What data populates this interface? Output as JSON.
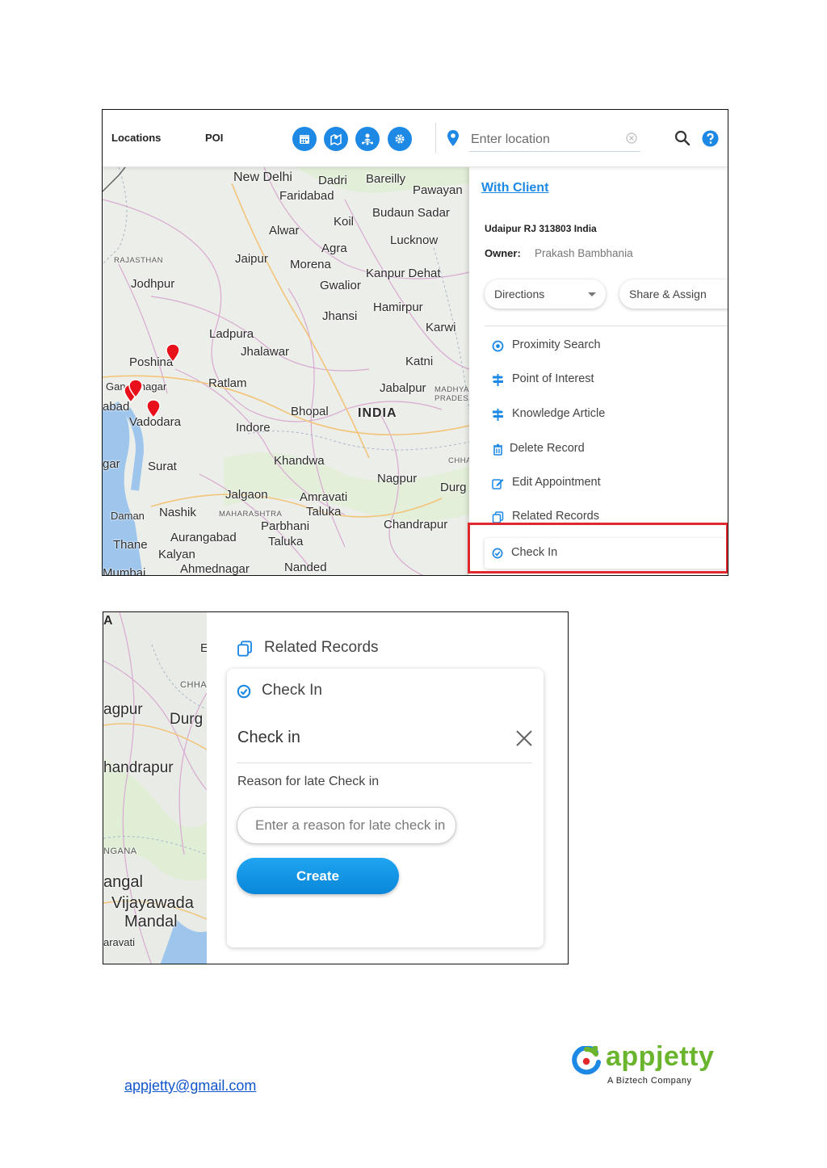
{
  "screen1": {
    "nav": {
      "locations": "Locations",
      "poi": "POI"
    },
    "toolbar_icons": [
      "calendar-icon",
      "map-route-icon",
      "user-network-icon",
      "settings-icon"
    ],
    "search": {
      "placeholder": "Enter location"
    },
    "map_labels": {
      "new_delhi": "New Delhi",
      "dadri": "Dadri",
      "bareilly": "Bareilly",
      "pawayan": "Pawayan",
      "faridabad": "Faridabad",
      "budaun_sadar": "Budaun Sadar",
      "koil": "Koil",
      "alwar": "Alwar",
      "lucknow": "Lucknow",
      "agra": "Agra",
      "rajasthan": "RAJASTHAN",
      "jaipur": "Jaipur",
      "morena": "Morena",
      "kanpur_dehat": "Kanpur Dehat",
      "jodhpur": "Jodhpur",
      "gwalior": "Gwalior",
      "hamirpur": "Hamirpur",
      "jhansi": "Jhansi",
      "karwi": "Karwi",
      "ladpura": "Ladpura",
      "jhalawar": "Jhalawar",
      "poshina": "Poshina",
      "katni": "Katni",
      "ratlam": "Ratlam",
      "jabalpur": "Jabalpur",
      "madhya": "MADHYA",
      "pradesh": "PRADESH",
      "bhopal": "Bhopal",
      "india": "INDIA",
      "vadodara": "Vadodara",
      "indore": "Indore",
      "khandwa": "Khandwa",
      "surat": "Surat",
      "nagpur": "Nagpur",
      "durg": "Durg",
      "jalgaon": "Jalgaon",
      "amravati_taluka": "Amravati",
      "taluka": "Taluka",
      "daman": "Daman",
      "nashik": "Nashik",
      "maharashtra": "MAHARASHTRA",
      "parbhani": "Parbhani",
      "chandrapur": "Chandrapur",
      "thane": "Thane",
      "aurangabad": "Aurangabad",
      "taluka2": "Taluka",
      "kalyan": "Kalyan",
      "nanded": "Nanded",
      "ahmednagar": "Ahmednagar",
      "mumbai": "Mumbai",
      "gandhinagar": "Gandhinagar",
      "ahmedabad": "abad",
      "gar": "gar",
      "chha": "CHHA"
    },
    "panel": {
      "title": "With Client",
      "address": "Udaipur RJ 313803 India",
      "owner_label": "Owner:",
      "owner_value": "Prakash Bambhania",
      "directions": "Directions",
      "share_assign": "Share & Assign",
      "menu": [
        {
          "label": "Proximity Search",
          "icon": "target-icon"
        },
        {
          "label": "Point of Interest",
          "icon": "signpost-icon"
        },
        {
          "label": "Knowledge Article",
          "icon": "signpost-icon"
        },
        {
          "label": "Delete Record",
          "icon": "trash-icon"
        },
        {
          "label": "Edit Appointment",
          "icon": "edit-icon"
        },
        {
          "label": "Related Records",
          "icon": "copy-icon"
        },
        {
          "label": "Check In",
          "icon": "check-circle-icon"
        }
      ]
    },
    "colors": {
      "accent": "#1e88e5",
      "highlight": "#e0282e",
      "pin": "#e8101a"
    }
  },
  "screen2": {
    "map_labels": {
      "a": "A",
      "e": "E",
      "chha": "CHHA",
      "nagpur": "agpur",
      "durg": "Durg",
      "chandrapur": "handrapur",
      "ngana": "NGANA",
      "angal": "angal",
      "vijayawada": "Vijayawada",
      "mandal": "Mandal",
      "aravati": "aravati"
    },
    "related_records": "Related Records",
    "check_in_item": "Check In",
    "dialog_title": "Check in",
    "reason_label": "Reason for late Check in",
    "reason_placeholder": "Enter a reason for late check in",
    "create_button": "Create"
  },
  "footer": {
    "email": "appjetty@gmail.com",
    "logo_text": "appjetty",
    "logo_tagline": "A Biztech Company",
    "logo_colors": {
      "green": "#6ab42e",
      "blue": "#1e88e5",
      "red": "#e0282e"
    }
  }
}
